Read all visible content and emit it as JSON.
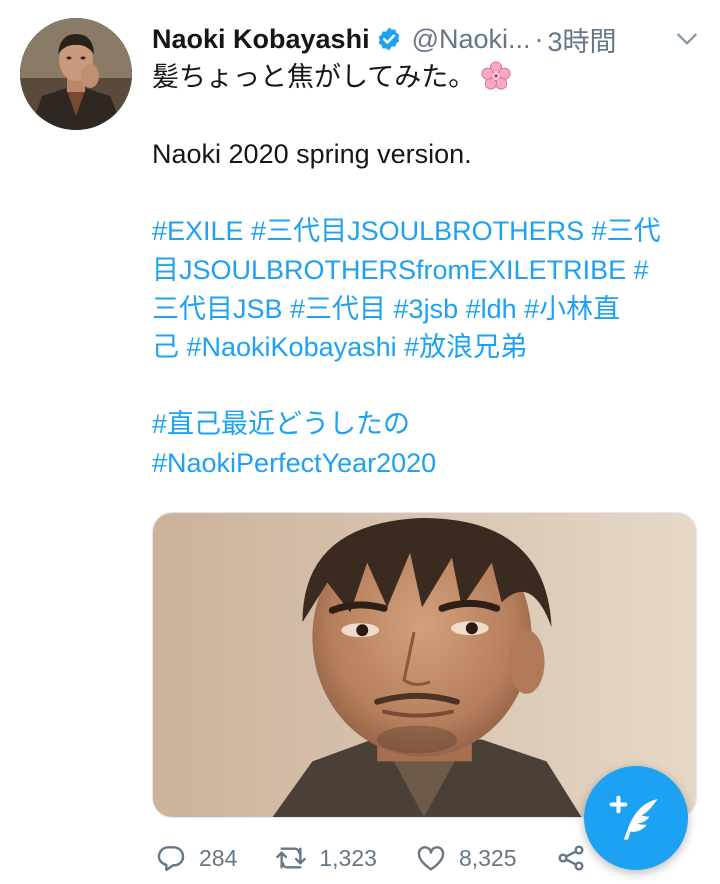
{
  "author": {
    "name": "Naoki Kobayashi",
    "handle": "@Naoki...",
    "separator": "·",
    "time": "3時間"
  },
  "tweet": {
    "lines": [
      "髪ちょっと焦がしてみた。",
      "",
      "Naoki 2020  spring version.",
      "",
      "#EXILE #三代目JSOULBROTHERS #三代",
      "目JSOULBROTHERSfromEXILETRIBE #",
      "三代目JSB #三代目 #3jsb #ldh #小林直",
      "己 #NaokiKobayashi #放浪兄弟",
      "",
      "#直己最近どうしたの",
      "#NaokiPerfectYear2020"
    ]
  },
  "actions": {
    "reply_count": "284",
    "retweet_count": "1,323",
    "like_count": "8,325"
  },
  "colors": {
    "link": "#1da1f2",
    "text": "#14171a",
    "muted": "#657786",
    "fab": "#1da1f2"
  },
  "icons": {
    "verified": "verified-badge-icon",
    "flower": "cherry-blossom-emoji",
    "menu": "chevron-down-icon",
    "reply": "reply-icon",
    "retweet": "retweet-icon",
    "like": "heart-icon",
    "share": "share-icon",
    "compose": "compose-tweet-icon"
  }
}
